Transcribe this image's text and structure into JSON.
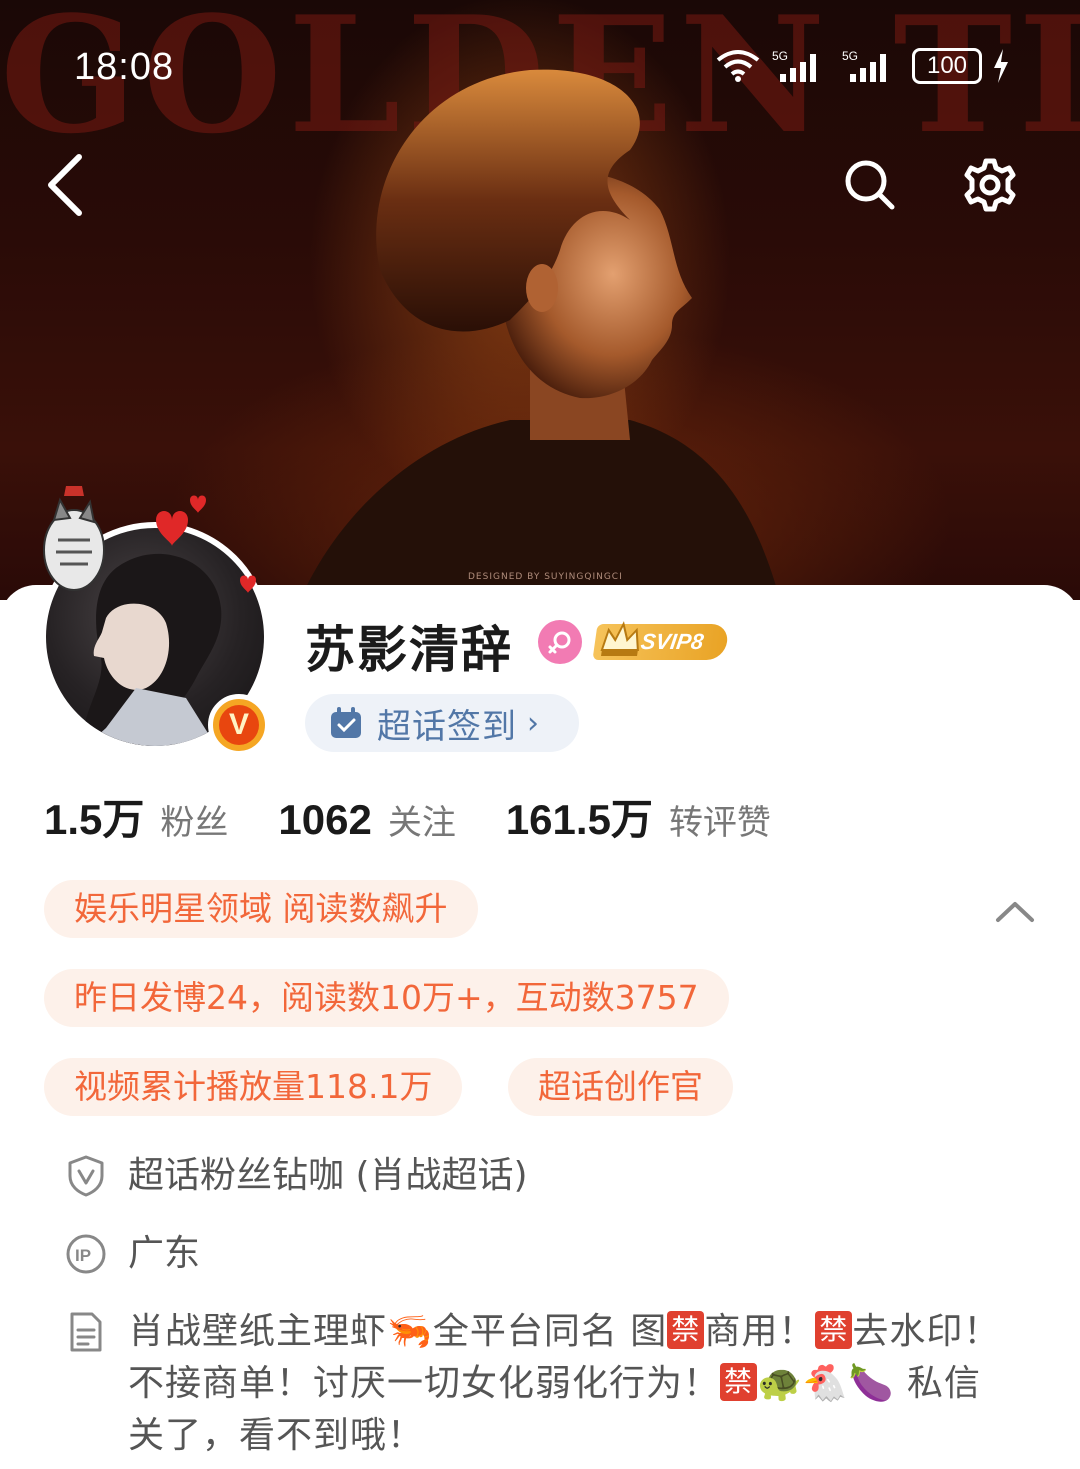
{
  "status_bar": {
    "time": "18:08",
    "signal1": "5G",
    "signal2": "5G",
    "battery": "100"
  },
  "banner": {
    "background_text": "GOLDEN TIME",
    "credit": "DESIGNED BY SUYINGQINGCI"
  },
  "profile": {
    "username": "苏影清辞",
    "svip_label": "SVIP8",
    "checkin_label": "超话签到",
    "stats": [
      {
        "value": "1.5万",
        "label": "粉丝"
      },
      {
        "value": "1062",
        "label": "关注"
      },
      {
        "value": "161.5万",
        "label": "转评赞"
      }
    ],
    "tags": {
      "domain": "娱乐明星领域 阅读数飙升",
      "yesterday": "昨日发博24，阅读数10万+，互动数3757",
      "video": "视频累计播放量118.1万",
      "role": "超话创作官"
    },
    "fan_level": "超话粉丝钻咖 (肖战超话)",
    "ip_location": "广东",
    "bio": {
      "part1": "肖战壁纸主理虾",
      "part2": "全平台同名 图",
      "part3": "商用！",
      "part4": "去水印！不接商单！讨厌一切女化弱化行为！",
      "part5": "私信关了，看不到哦！",
      "ban_char": "禁",
      "emoji_shrimp": "🦐",
      "emoji_turtle": "🐢",
      "emoji_chicken": "🐔",
      "emoji_eggplant": "🍆"
    }
  },
  "colors": {
    "accent_orange": "#f2673a",
    "tag_bg": "#fdf1ea",
    "checkin_blue": "#5277a7",
    "svip_gold": "#e9a325",
    "verified_orange": "#e8460f"
  }
}
